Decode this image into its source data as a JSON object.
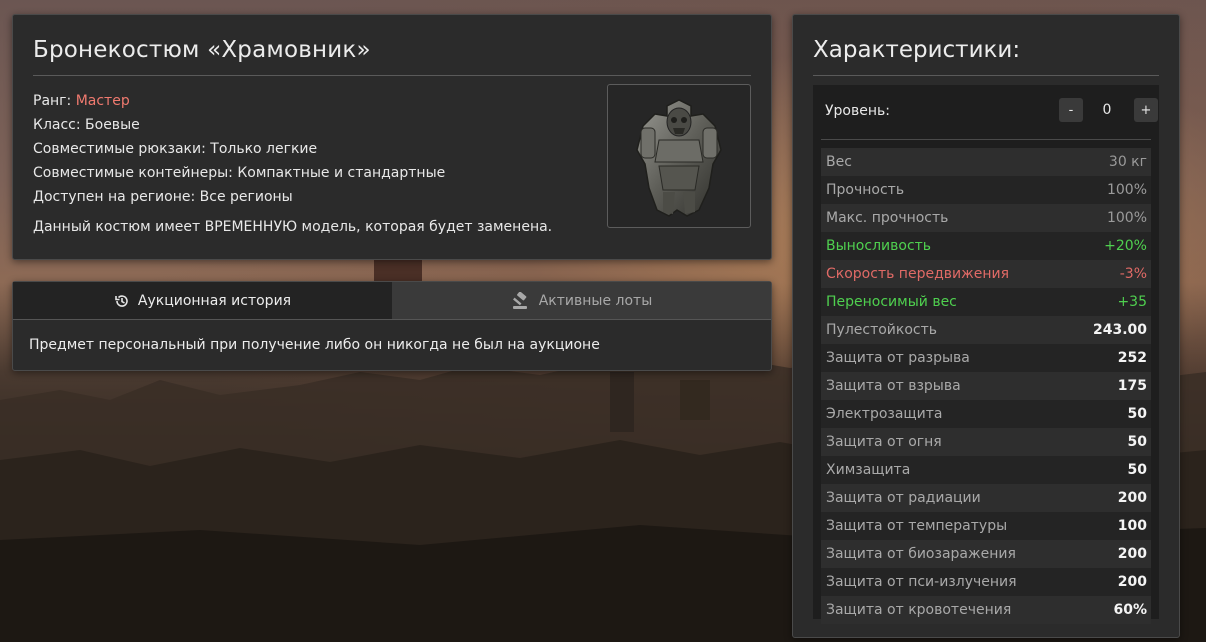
{
  "item": {
    "title": "Бронекостюм «Храмовник»",
    "rank_label": "Ранг: ",
    "rank_value": "Мастер",
    "class_line": "Класс: Боевые",
    "backpacks_line": "Совместимые рюкзаки: Только легкие",
    "containers_line": "Совместимые контейнеры: Компактные и стандартные",
    "region_line": "Доступен на регионе: Все регионы",
    "note": "Данный костюм имеет ВРЕМЕННУЮ модель, которая будет заменена."
  },
  "auction": {
    "tab_history": "Аукционная история",
    "tab_lots": "Активные лоты",
    "message": "Предмет персональный при получение либо он никогда не был на аукционе"
  },
  "stats": {
    "title": "Характеристики:",
    "level_label": "Уровень:",
    "level_minus": "-",
    "level_value": "0",
    "level_plus": "+",
    "rows": [
      {
        "name": "Вес",
        "value": "30 кг",
        "style": "muted"
      },
      {
        "name": "Прочность",
        "value": "100%",
        "style": "muted"
      },
      {
        "name": "Макс. прочность",
        "value": "100%",
        "style": "muted"
      },
      {
        "name": "Выносливость",
        "value": "+20%",
        "style": "good"
      },
      {
        "name": "Скорость передвижения",
        "value": "-3%",
        "style": "bad"
      },
      {
        "name": "Переносимый вес",
        "value": "+35",
        "style": "good"
      },
      {
        "name": "Пулестойкость",
        "value": "243.00",
        "style": "bold"
      },
      {
        "name": "Защита от разрыва",
        "value": "252",
        "style": "bold"
      },
      {
        "name": "Защита от взрыва",
        "value": "175",
        "style": "bold"
      },
      {
        "name": "Электрозащита",
        "value": "50",
        "style": "bold"
      },
      {
        "name": "Защита от огня",
        "value": "50",
        "style": "bold"
      },
      {
        "name": "Химзащита",
        "value": "50",
        "style": "bold"
      },
      {
        "name": "Защита от радиации",
        "value": "200",
        "style": "bold"
      },
      {
        "name": "Защита от температуры",
        "value": "100",
        "style": "bold"
      },
      {
        "name": "Защита от биозаражения",
        "value": "200",
        "style": "bold"
      },
      {
        "name": "Защита от пси-излучения",
        "value": "200",
        "style": "bold"
      },
      {
        "name": "Защита от кровотечения",
        "value": "60%",
        "style": "bold"
      }
    ]
  },
  "icons": {
    "history": "history-icon",
    "gavel": "gavel-icon",
    "armor": "armor-suit-icon"
  },
  "colors": {
    "rank": "#f07a6f",
    "positive": "#4fd04f",
    "negative": "#e06a66"
  }
}
